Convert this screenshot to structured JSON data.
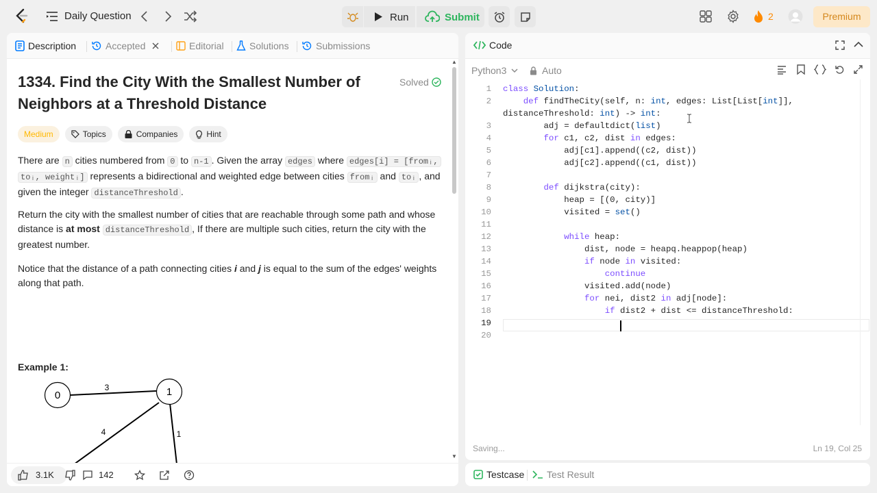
{
  "header": {
    "title": "Daily Question",
    "run_label": "Run",
    "submit_label": "Submit",
    "streak_count": "2",
    "premium_label": "Premium",
    "accent_color": "#2db55d",
    "icons": [
      "logo-icon",
      "list-icon",
      "chevron-left-icon",
      "chevron-right-icon",
      "shuffle-icon",
      "bug-icon",
      "play-icon",
      "cloud-upload-icon",
      "alarm-icon",
      "note-icon",
      "layout-icon",
      "gear-icon",
      "fire-icon",
      "avatar-icon"
    ]
  },
  "left_tabs": [
    {
      "label": "Description",
      "active": true
    },
    {
      "label": "Accepted",
      "active": false
    },
    {
      "label": "Editorial",
      "active": false
    },
    {
      "label": "Solutions",
      "active": false
    },
    {
      "label": "Submissions",
      "active": false
    }
  ],
  "problem": {
    "title": "1334. Find the City With the Smallest Number of Neighbors at a Threshold Distance",
    "status": "Solved",
    "difficulty": "Medium",
    "chips": [
      "Topics",
      "Companies",
      "Hint"
    ],
    "p1": {
      "t1": "There are ",
      "c1": "n",
      "t2": " cities numbered from ",
      "c2": "0",
      "t3": " to ",
      "c3": "n-1",
      "t4": ". Given the array ",
      "c4": "edges",
      "t5": " where ",
      "c5": "edges[i] = [fromᵢ,",
      "c6": "toᵢ, weightᵢ]",
      "t6": " represents a bidirectional and weighted edge between cities ",
      "c7": "fromᵢ",
      "t7": " and ",
      "c8": "toᵢ",
      "t8": ", and given the integer ",
      "c9": "distanceThreshold",
      "t9": "."
    },
    "p2": {
      "t1": "Return the city with the smallest number of cities that are reachable through some path and whose distance is ",
      "b1": "at most",
      "t2": " ",
      "c1": "distanceThreshold",
      "t3": ", If there are multiple such cities, return the city with the greatest number."
    },
    "p3": {
      "t1": "Notice that the distance of a path connecting cities ",
      "i1": "i",
      "t2": " and ",
      "i2": "j",
      "t3": " is equal to the sum of the edges' weights along that path."
    },
    "example_title": "Example 1:",
    "graph": {
      "nodes": [
        "0",
        "1"
      ],
      "edge_weights": [
        "3",
        "4",
        "1"
      ]
    }
  },
  "left_footer": {
    "likes": "3.1K",
    "comments": "142"
  },
  "code_panel": {
    "tab_label": "Code",
    "language": "Python3",
    "mode": "Auto",
    "status_left": "Saving...",
    "status_right": "Ln 19, Col 25",
    "line_numbers": [
      "1",
      "2",
      "",
      "3",
      "4",
      "5",
      "6",
      "7",
      "8",
      "9",
      "10",
      "11",
      "12",
      "13",
      "14",
      "15",
      "16",
      "17",
      "18",
      "19",
      "20"
    ],
    "lines": [
      "class Solution:",
      "    def findTheCity(self, n: int, edges: List[List[int]],",
      "distanceThreshold: int) -> int:",
      "        adj = defaultdict(list)",
      "        for c1, c2, dist in edges:",
      "            adj[c1].append((c2, dist))",
      "            adj[c2].append((c1, dist))",
      "",
      "        def dijkstra(city):",
      "            heap = [(0, city)]",
      "            visited = set()",
      "",
      "            while heap:",
      "                dist, node = heapq.heappop(heap)",
      "                if node in visited:",
      "                    continue",
      "                visited.add(node)",
      "                for nei, dist2 in adj[node]:",
      "                    if dist2 + dist <= distanceThreshold:",
      "",
      ""
    ]
  },
  "bottom_tabs": [
    {
      "label": "Testcase",
      "active": true
    },
    {
      "label": "Test Result",
      "active": false
    }
  ]
}
